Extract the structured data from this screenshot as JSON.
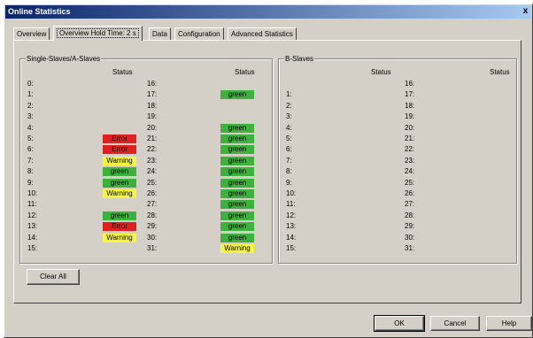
{
  "window": {
    "title": "Online Statistics",
    "close_glyph": "x"
  },
  "tabs": [
    {
      "label": "Overview"
    },
    {
      "label": "Overview  Hold Time: 2 s",
      "active": true
    },
    {
      "label": "Data"
    },
    {
      "label": "Configuration"
    },
    {
      "label": "Advanced Statistics"
    }
  ],
  "colors": {
    "green": "#3cb23c",
    "Error": "#e02020",
    "Warning": "#f6f640"
  },
  "single_group": {
    "title": "Single-Slaves/A-Slaves",
    "status_header": "Status",
    "left": [
      {
        "label": "0:",
        "status": ""
      },
      {
        "label": "1:",
        "status": ""
      },
      {
        "label": "2:",
        "status": ""
      },
      {
        "label": "3:",
        "status": ""
      },
      {
        "label": "4:",
        "status": ""
      },
      {
        "label": "5:",
        "status": "Error"
      },
      {
        "label": "6:",
        "status": "Error"
      },
      {
        "label": "7:",
        "status": "Warning"
      },
      {
        "label": "8:",
        "status": "green"
      },
      {
        "label": "9:",
        "status": "green"
      },
      {
        "label": "10:",
        "status": "Warning"
      },
      {
        "label": "11:",
        "status": ""
      },
      {
        "label": "12:",
        "status": "green"
      },
      {
        "label": "13:",
        "status": "Error"
      },
      {
        "label": "14:",
        "status": "Warning"
      },
      {
        "label": "15:",
        "status": ""
      }
    ],
    "right": [
      {
        "label": "16:",
        "status": ""
      },
      {
        "label": "17:",
        "status": "green"
      },
      {
        "label": "18:",
        "status": ""
      },
      {
        "label": "19:",
        "status": ""
      },
      {
        "label": "20:",
        "status": "green"
      },
      {
        "label": "21:",
        "status": "green"
      },
      {
        "label": "22:",
        "status": "green"
      },
      {
        "label": "23:",
        "status": "green"
      },
      {
        "label": "24:",
        "status": "green"
      },
      {
        "label": "25:",
        "status": "green"
      },
      {
        "label": "26:",
        "status": "green"
      },
      {
        "label": "27:",
        "status": "green"
      },
      {
        "label": "28:",
        "status": "green"
      },
      {
        "label": "29:",
        "status": "green"
      },
      {
        "label": "30:",
        "status": "green"
      },
      {
        "label": "31:",
        "status": "Warning"
      }
    ]
  },
  "b_group": {
    "title": "B-Slaves",
    "status_header": "Status",
    "left": [
      {
        "label": "",
        "status": ""
      },
      {
        "label": "1:",
        "status": ""
      },
      {
        "label": "2:",
        "status": ""
      },
      {
        "label": "3:",
        "status": ""
      },
      {
        "label": "4:",
        "status": ""
      },
      {
        "label": "5:",
        "status": ""
      },
      {
        "label": "6:",
        "status": ""
      },
      {
        "label": "7:",
        "status": ""
      },
      {
        "label": "8:",
        "status": ""
      },
      {
        "label": "9:",
        "status": ""
      },
      {
        "label": "10:",
        "status": ""
      },
      {
        "label": "11:",
        "status": ""
      },
      {
        "label": "12:",
        "status": ""
      },
      {
        "label": "13:",
        "status": ""
      },
      {
        "label": "14:",
        "status": ""
      },
      {
        "label": "15:",
        "status": ""
      }
    ],
    "right": [
      {
        "label": "16:",
        "status": ""
      },
      {
        "label": "17:",
        "status": ""
      },
      {
        "label": "18:",
        "status": ""
      },
      {
        "label": "19:",
        "status": ""
      },
      {
        "label": "20:",
        "status": ""
      },
      {
        "label": "21:",
        "status": ""
      },
      {
        "label": "22:",
        "status": ""
      },
      {
        "label": "23:",
        "status": ""
      },
      {
        "label": "24:",
        "status": ""
      },
      {
        "label": "25:",
        "status": ""
      },
      {
        "label": "26:",
        "status": ""
      },
      {
        "label": "27:",
        "status": ""
      },
      {
        "label": "28:",
        "status": ""
      },
      {
        "label": "29:",
        "status": ""
      },
      {
        "label": "30:",
        "status": ""
      },
      {
        "label": "31:",
        "status": ""
      }
    ]
  },
  "buttons": {
    "clear_all": "Clear All",
    "ok": "OK",
    "cancel": "Cancel",
    "help": "Help"
  }
}
